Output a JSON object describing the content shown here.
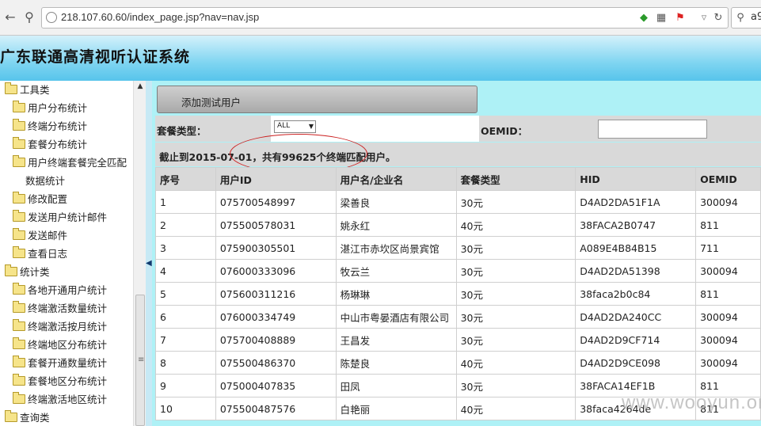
{
  "browser": {
    "url": "218.107.60.60/index_page.jsp?nav=nav.jsp",
    "search_text": "a9"
  },
  "header": {
    "title": "广东联通高清视听认证系统"
  },
  "sidebar": {
    "items": [
      {
        "label": "工具类",
        "level": 0,
        "folder": true
      },
      {
        "label": "用户分布统计",
        "level": 1,
        "folder": true
      },
      {
        "label": "终端分布统计",
        "level": 1,
        "folder": true
      },
      {
        "label": "套餐分布统计",
        "level": 1,
        "folder": true
      },
      {
        "label": "用户终端套餐完全匹配",
        "level": 1,
        "folder": true
      },
      {
        "label": "数据统计",
        "level": 1,
        "folder": false
      },
      {
        "label": "修改配置",
        "level": 1,
        "folder": true
      },
      {
        "label": "发送用户统计邮件",
        "level": 1,
        "folder": true
      },
      {
        "label": "发送邮件",
        "level": 1,
        "folder": true
      },
      {
        "label": "查看日志",
        "level": 1,
        "folder": true
      },
      {
        "label": "统计类",
        "level": 0,
        "folder": true
      },
      {
        "label": "各地开通用户统计",
        "level": 1,
        "folder": true
      },
      {
        "label": "终端激活数量统计",
        "level": 1,
        "folder": true
      },
      {
        "label": "终端激活按月统计",
        "level": 1,
        "folder": true
      },
      {
        "label": "终端地区分布统计",
        "level": 1,
        "folder": true
      },
      {
        "label": "套餐开通数量统计",
        "level": 1,
        "folder": true
      },
      {
        "label": "套餐地区分布统计",
        "level": 1,
        "folder": true
      },
      {
        "label": "终端激活地区统计",
        "level": 1,
        "folder": true
      },
      {
        "label": "查询类",
        "level": 0,
        "folder": true
      }
    ]
  },
  "main": {
    "add_button_label": "添加测试用户",
    "package_type_label": "套餐类型：",
    "package_type_value": "ALL",
    "oemid_label": "OEMID：",
    "oemid_value": "",
    "summary": "截止到2015-07-01，共有99625个终端匹配用户。"
  },
  "table": {
    "columns": [
      "序号",
      "用户ID",
      "用户名/企业名",
      "套餐类型",
      "HID",
      "OEMID"
    ],
    "rows": [
      [
        "1",
        "075700548997",
        "梁善良",
        "30元",
        "D4AD2DA51F1A",
        "300094"
      ],
      [
        "2",
        "075500578031",
        "姚永红",
        "40元",
        "38FACA2B0747",
        "811"
      ],
      [
        "3",
        "075900305501",
        "湛江市赤坎区尚景宾馆",
        "30元",
        "A089E4B84B15",
        "711"
      ],
      [
        "4",
        "076000333096",
        "牧云兰",
        "30元",
        "D4AD2DA51398",
        "300094"
      ],
      [
        "5",
        "075600311216",
        "杨琳琳",
        "30元",
        "38faca2b0c84",
        "811"
      ],
      [
        "6",
        "076000334749",
        "中山市粤晏酒店有限公司",
        "30元",
        "D4AD2DA240CC",
        "300094"
      ],
      [
        "7",
        "075700408889",
        "王昌发",
        "30元",
        "D4AD2D9CF714",
        "300094"
      ],
      [
        "8",
        "075500486370",
        "陈楚良",
        "40元",
        "D4AD2D9CE098",
        "300094"
      ],
      [
        "9",
        "075000407835",
        "田凤",
        "30元",
        "38FACA14EF1B",
        "811"
      ],
      [
        "10",
        "075500487576",
        "白艳丽",
        "40元",
        "38faca4264de",
        "811"
      ]
    ]
  },
  "watermark": "www.wooyun.org"
}
